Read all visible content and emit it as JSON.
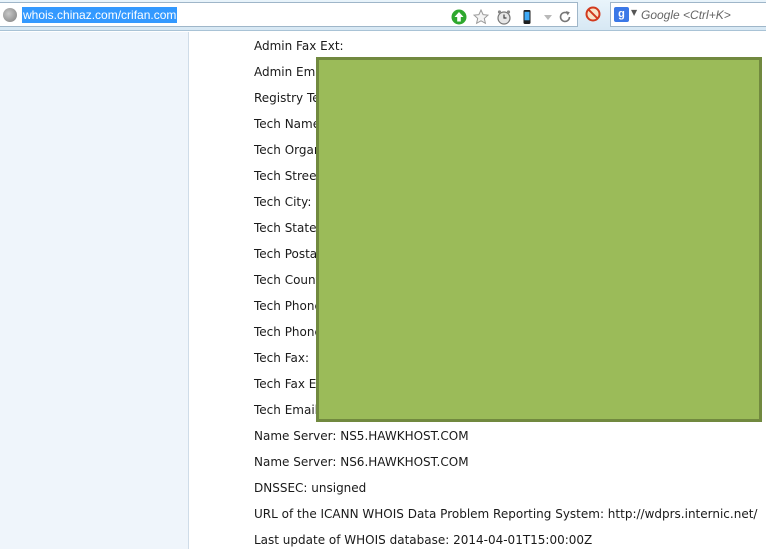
{
  "browser": {
    "url": "whois.chinaz.com/crifan.com",
    "search_placeholder": "Google <Ctrl+K>",
    "toolbar_icons": [
      "globe-icon",
      "green-up-arrow-icon",
      "star-icon",
      "clock-icon",
      "phone-icon",
      "dropdown-arrow-icon",
      "reload-icon",
      "no-script-icon",
      "google-icon"
    ]
  },
  "whois": {
    "lines": [
      "Admin Fax Ext:",
      "Admin Ema",
      "Registry Te",
      "Tech Name",
      "Tech Orgar",
      "Tech Stree",
      "Tech City: ",
      "Tech State",
      "Tech Posta",
      "Tech Count",
      "Tech Phone",
      "Tech Phone",
      "Tech Fax:",
      "Tech Fax E",
      "Tech Email:",
      "Name Server: NS5.HAWKHOST.COM",
      "Name Server: NS6.HAWKHOST.COM",
      "DNSSEC: unsigned",
      "URL of the ICANN WHOIS Data Problem Reporting System: http://wdprs.internic.net/",
      "Last update of WHOIS database: 2014-04-01T15:00:00Z"
    ]
  },
  "colors": {
    "redaction_fill": "#9bbb59",
    "redaction_border": "#71893f",
    "url_highlight": "#3399ff"
  }
}
